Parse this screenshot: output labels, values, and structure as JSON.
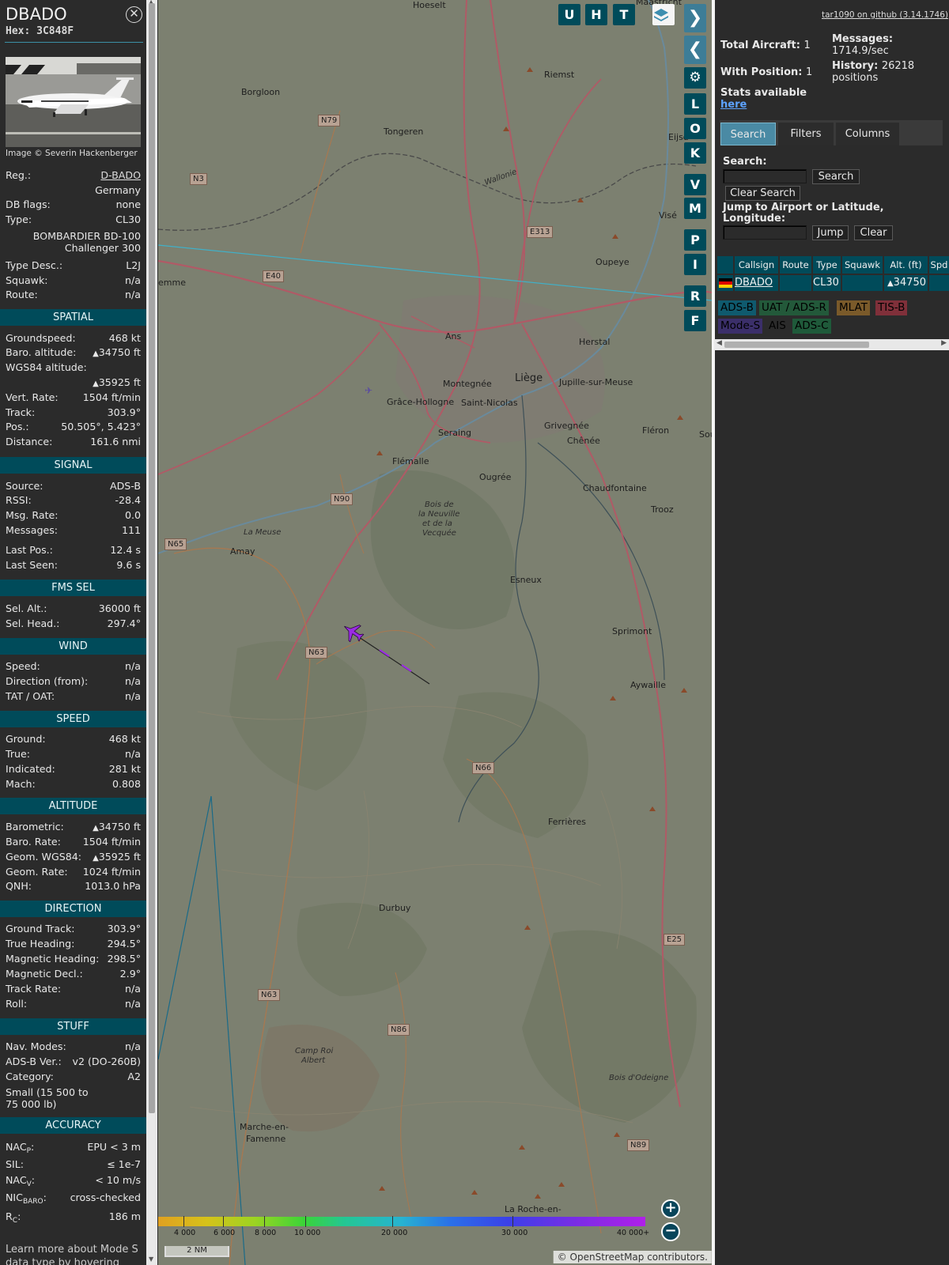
{
  "info": {
    "callsign": "DBADO",
    "hex_label": "Hex:",
    "hex": "3C848F",
    "photo_credit": "Image © Severin Hackenberger",
    "reg_label": "Reg.:",
    "reg": "D-BADO",
    "country": "Germany",
    "dbflags_label": "DB flags:",
    "dbflags": "none",
    "type_label": "Type:",
    "type": "CL30",
    "type_name_1": "BOMBARDIER BD-100",
    "type_name_2": "Challenger 300",
    "typedesc_label": "Type Desc.:",
    "typedesc": "L2J",
    "squawk_label": "Squawk:",
    "squawk": "n/a",
    "route_label": "Route:",
    "route": "n/a"
  },
  "spatial": {
    "title": "SPATIAL",
    "groundspeed_label": "Groundspeed:",
    "groundspeed": "468 kt",
    "baro_label": "Baro. altitude:",
    "baro": "34750 ft",
    "wgs_label": "WGS84 altitude:",
    "wgs": "35925 ft",
    "vert_label": "Vert. Rate:",
    "vert": "1504 ft/min",
    "track_label": "Track:",
    "track": "303.9°",
    "pos_label": "Pos.:",
    "pos": "50.505°, 5.423°",
    "dist_label": "Distance:",
    "dist": "161.6 nmi"
  },
  "signal": {
    "title": "SIGNAL",
    "source_label": "Source:",
    "source": "ADS-B",
    "rssi_label": "RSSI:",
    "rssi": "-28.4",
    "msgrate_label": "Msg. Rate:",
    "msgrate": "0.0",
    "messages_label": "Messages:",
    "messages": "111",
    "lastpos_label": "Last Pos.:",
    "lastpos": "12.4 s",
    "lastseen_label": "Last Seen:",
    "lastseen": "9.6 s"
  },
  "fms": {
    "title": "FMS SEL",
    "selalt_label": "Sel. Alt.:",
    "selalt": "36000 ft",
    "selhead_label": "Sel. Head.:",
    "selhead": "297.4°"
  },
  "wind": {
    "title": "WIND",
    "speed_label": "Speed:",
    "speed": "n/a",
    "dir_label": "Direction (from):",
    "dir": "n/a",
    "tat_label": "TAT / OAT:",
    "tat": "n/a"
  },
  "speed": {
    "title": "SPEED",
    "ground_label": "Ground:",
    "ground": "468 kt",
    "true_label": "True:",
    "true": "n/a",
    "ind_label": "Indicated:",
    "ind": "281 kt",
    "mach_label": "Mach:",
    "mach": "0.808"
  },
  "altitude": {
    "title": "ALTITUDE",
    "baro_label": "Barometric:",
    "baro": "34750 ft",
    "barorate_label": "Baro. Rate:",
    "barorate": "1504 ft/min",
    "geom_label": "Geom. WGS84:",
    "geom": "35925 ft",
    "geomrate_label": "Geom. Rate:",
    "geomrate": "1024 ft/min",
    "qnh_label": "QNH:",
    "qnh": "1013.0 hPa"
  },
  "direction": {
    "title": "DIRECTION",
    "gtrack_label": "Ground Track:",
    "gtrack": "303.9°",
    "thead_label": "True Heading:",
    "thead": "294.5°",
    "mhead_label": "Magnetic Heading:",
    "mhead": "298.5°",
    "mdecl_label": "Magnetic Decl.:",
    "mdecl": "2.9°",
    "trate_label": "Track Rate:",
    "trate": "n/a",
    "roll_label": "Roll:",
    "roll": "n/a"
  },
  "stuff": {
    "title": "STUFF",
    "nav_label": "Nav. Modes:",
    "nav": "n/a",
    "adsb_label": "ADS-B Ver.:",
    "adsb": "v2 (DO-260B)",
    "cat_label": "Category:",
    "cat": "A2",
    "cat_desc_1": "Small (15 500 to",
    "cat_desc_2": "75 000 lb)"
  },
  "accuracy": {
    "title": "ACCURACY",
    "nacp_label": "NAC",
    "nacp_sub": "P",
    "nacp": "EPU < 3 m",
    "sil_label": "SIL:",
    "sil": "≤ 1e-7",
    "nacv_label": "NAC",
    "nacv_sub": "V",
    "nacv": "< 10 m/s",
    "nic_label": "NIC",
    "nic_sub": "BARO",
    "nic": "cross-checked",
    "rc_label": "R",
    "rc_sub": "C",
    "rc": "186 m"
  },
  "learn_more": "Learn more about Mode S data type by hovering over",
  "map": {
    "buttons_top": [
      "U",
      "H",
      "T"
    ],
    "buttons_side": [
      "L",
      "O",
      "K",
      "V",
      "M",
      "P",
      "I",
      "R",
      "F"
    ],
    "labels": {
      "hoeselt": "Hoeselt",
      "maastricht": "Maastricht",
      "borgloon": "Borgloon",
      "riemst": "Riemst",
      "tongeren": "Tongeren",
      "eijsden": "Eijsd",
      "vise": "Visé",
      "oupeye": "Oupeye",
      "remme": "emme",
      "ans": "Ans",
      "herstal": "Herstal",
      "montegnee": "Montegnée",
      "liege": "Liège",
      "jupille": "Jupille-sur-Meuse",
      "grace": "Grâce-Hollogne",
      "saintnicolas": "Saint-Nicolas",
      "seraing": "Seraing",
      "grivegnee": "Grivegnée",
      "chenee": "Chênée",
      "fleron": "Fléron",
      "sou": "Sou",
      "flemalle": "Flémalle",
      "ougree": "Ougrée",
      "chaudfontaine": "Chaudfontaine",
      "trooz": "Trooz",
      "amay": "Amay",
      "esneux": "Esneux",
      "sprimont": "Sprimont",
      "aywaille": "Aywaille",
      "ferrieres": "Ferrières",
      "durbuy": "Durbuy",
      "marche1": "Marche-en-",
      "marche2": "Famenne",
      "larochelbl": "La Roche-en-",
      "bois1": "Bois de",
      "bois2": "la Neuville",
      "bois3": "et de la",
      "bois4": "Vecquée",
      "camp1": "Camp Roi",
      "camp2": "Albert",
      "boisodeigne": "Bois d'Odeigne",
      "lameuse": "La Meuse",
      "wallonie": "Wallonie"
    },
    "shields": {
      "n79": "N79",
      "n3": "N3",
      "e40": "E40",
      "e313": "E313",
      "n90": "N90",
      "n65": "N65",
      "n63a": "N63",
      "n66": "N66",
      "n63b": "N63",
      "n86": "N86",
      "e25": "E25",
      "n89": "N89"
    },
    "alt_ticks": [
      "4 000",
      "6 000",
      "8 000",
      "10 000",
      "20 000",
      "30 000",
      "40 000+"
    ],
    "scale": "2 NM",
    "attribution": "© OpenStreetMap contributors."
  },
  "sidebar": {
    "github": "tar1090 on github (3.14.1746)",
    "total_label": "Total Aircraft:",
    "total": "1",
    "withpos_label": "With Position:",
    "withpos": "1",
    "messages_label": "Messages:",
    "messages": "1714.9/sec",
    "history_label": "History:",
    "history": "26218",
    "history_unit": "positions",
    "stats_label": "Stats available",
    "stats_link": "here",
    "tabs": [
      "Search",
      "Filters",
      "Columns"
    ],
    "search_label": "Search:",
    "search_btn": "Search",
    "clear_search_btn": "Clear Search",
    "jump_label": "Jump to Airport or Latitude, Longitude:",
    "jump_btn": "Jump",
    "clear_btn": "Clear",
    "columns": [
      "Callsign",
      "Route",
      "Type",
      "Squawk",
      "Alt. (ft)",
      "Spd"
    ],
    "row": {
      "callsign": "DBADO",
      "route": "",
      "type": "CL30",
      "squawk": "",
      "alt": "34750",
      "spd": ""
    },
    "legend": [
      "ADS-B",
      "UAT / ADS-R",
      "MLAT",
      "TIS-B",
      "Mode-S",
      "AIS",
      "ADS-C"
    ]
  },
  "colors": {
    "accent": "#004b5a",
    "aircraft": "#9b2ce5",
    "legend_adsb": "#0f5a6e",
    "legend_uat": "#23593a",
    "legend_mlat": "#7a5a2a",
    "legend_tisb": "#80303a",
    "legend_modes": "#3b2f6a",
    "legend_ais": "#2b2b2b",
    "legend_adsc": "#1f5a3a"
  }
}
